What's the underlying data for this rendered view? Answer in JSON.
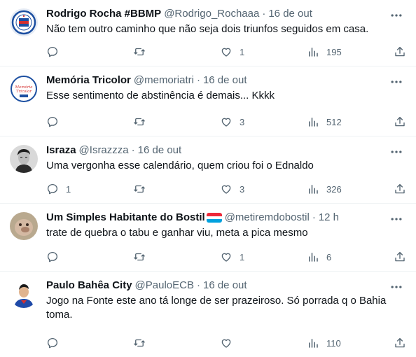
{
  "tweets": [
    {
      "name": "Rodrigo Rocha #BBMP",
      "handle": "@Rodrigo_Rochaaa",
      "separator": "·",
      "time": "16 de out",
      "text": "Não tem outro caminho que não seja dois triunfos seguidos em casa.",
      "replies": "",
      "retweets": "",
      "likes": "1",
      "views": "195",
      "avatar_icon": "bahia-crest-avatar"
    },
    {
      "name": "Memória Tricolor",
      "handle": "@memoriatri",
      "separator": "·",
      "time": "16 de out",
      "text": "Esse sentimento de abstinência é demais... Kkkk",
      "replies": "",
      "retweets": "",
      "likes": "3",
      "views": "512",
      "avatar_icon": "memoria-tricolor-logo",
      "avatar_logo_text": "Memória Tricolor"
    },
    {
      "name": "Israza",
      "handle": "@Israzzza",
      "separator": "·",
      "time": "16 de out",
      "text": "Uma vergonha esse calendário, quem criou foi o Ednaldo",
      "replies": "1",
      "retweets": "",
      "likes": "3",
      "views": "326",
      "avatar_icon": "bw-portrait-avatar"
    },
    {
      "name": "Um Simples Habitante do Bostil",
      "handle": "@metiremdobostil",
      "separator": "·",
      "time": "12 h",
      "text": "trate de quebra o tabu e ganhar viu, meta a pica mesmo",
      "replies": "",
      "retweets": "",
      "likes": "1",
      "views": "6",
      "avatar_icon": "creature-avatar",
      "name_emoji": "luxembourg-flag-icon"
    },
    {
      "name": "Paulo Bahêa City",
      "handle": "@PauloECB",
      "separator": "·",
      "time": "16 de out",
      "text": "Jogo na Fonte este ano tá longe de ser prazeiroso. Só porrada q o Bahia toma.",
      "replies": "",
      "retweets": "",
      "likes": "",
      "views": "110",
      "avatar_icon": "superhero-avatar"
    }
  ],
  "colors": {
    "text_primary": "#0f1419",
    "text_secondary": "#536471",
    "divider": "#eff3f4"
  }
}
